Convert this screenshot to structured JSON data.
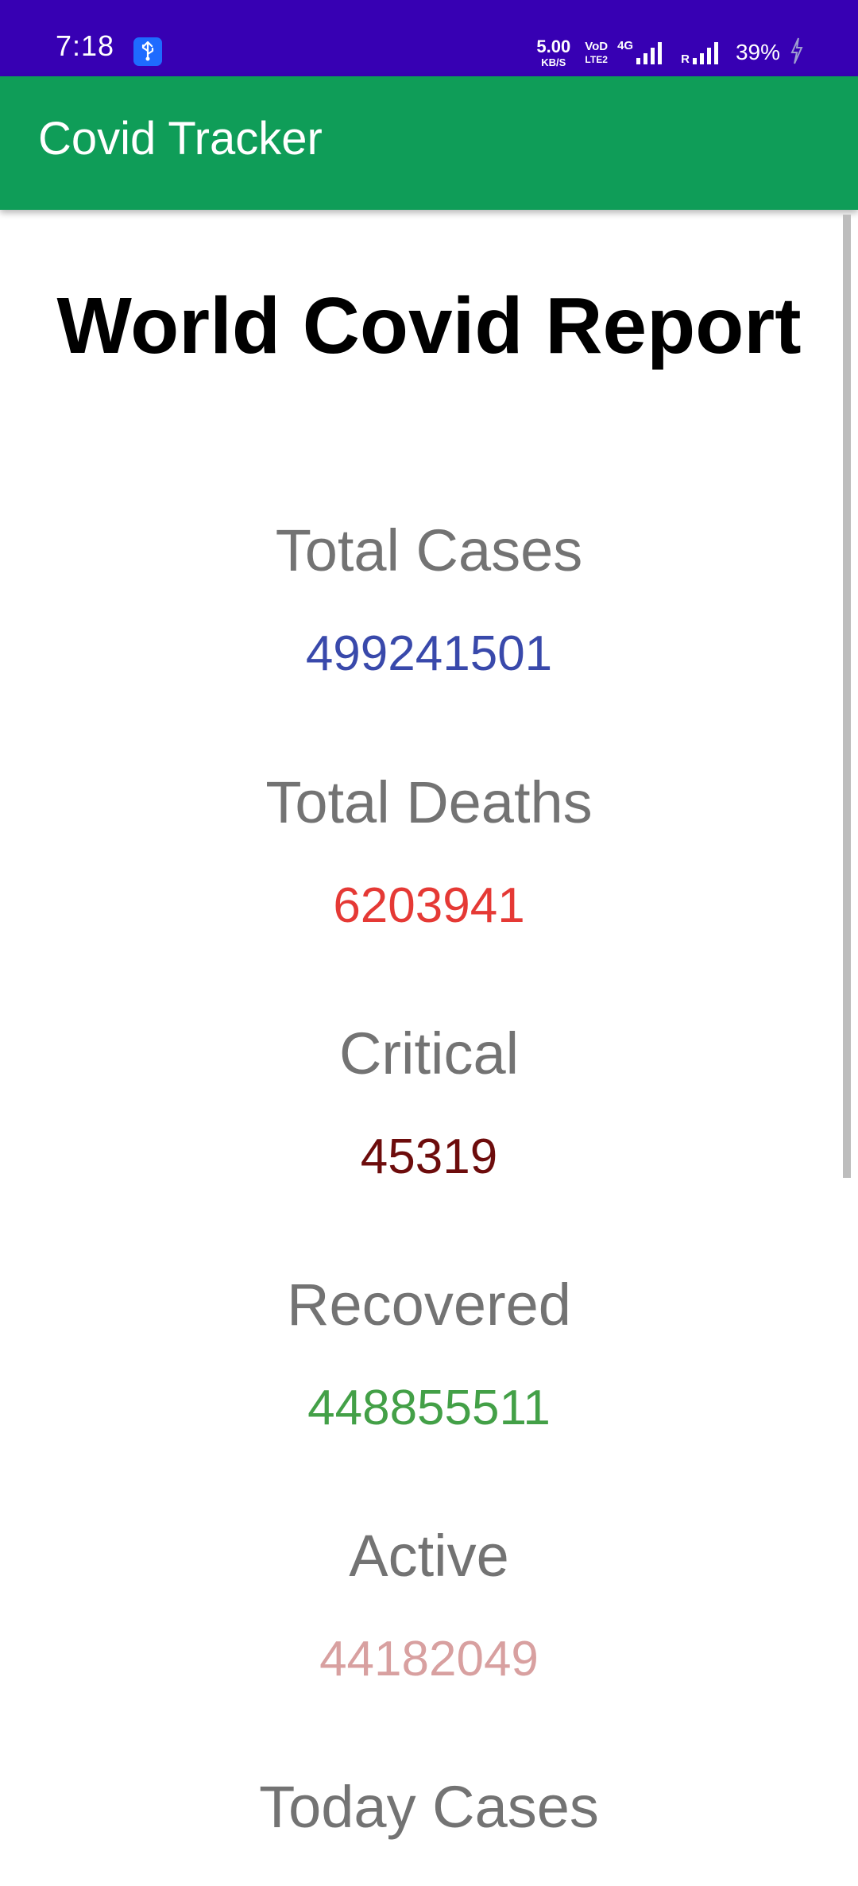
{
  "status_bar": {
    "time": "7:18",
    "network_speed": "5.00",
    "network_speed_unit": "KB/S",
    "volte_top": "VoD",
    "volte_bottom": "LTE2",
    "network_type": "4G",
    "roaming": "R",
    "battery": "39%",
    "icons": [
      "usb-icon",
      "signal-icon",
      "signal-icon",
      "charging-icon"
    ]
  },
  "app_bar": {
    "title": "Covid Tracker",
    "color": "#0f9d58"
  },
  "report": {
    "title": "World Covid Report",
    "stats": [
      {
        "label": "Total Cases",
        "value": "499241501",
        "color": "#3949ab"
      },
      {
        "label": "Total Deaths",
        "value": "6203941",
        "color": "#e53935"
      },
      {
        "label": "Critical",
        "value": "45319",
        "color": "#6d0c0c"
      },
      {
        "label": "Recovered",
        "value": "448855511",
        "color": "#43a047"
      },
      {
        "label": "Active",
        "value": "44182049",
        "color": "#d8a0a0"
      },
      {
        "label": "Today Cases",
        "value": "",
        "color": "#737373"
      }
    ]
  }
}
